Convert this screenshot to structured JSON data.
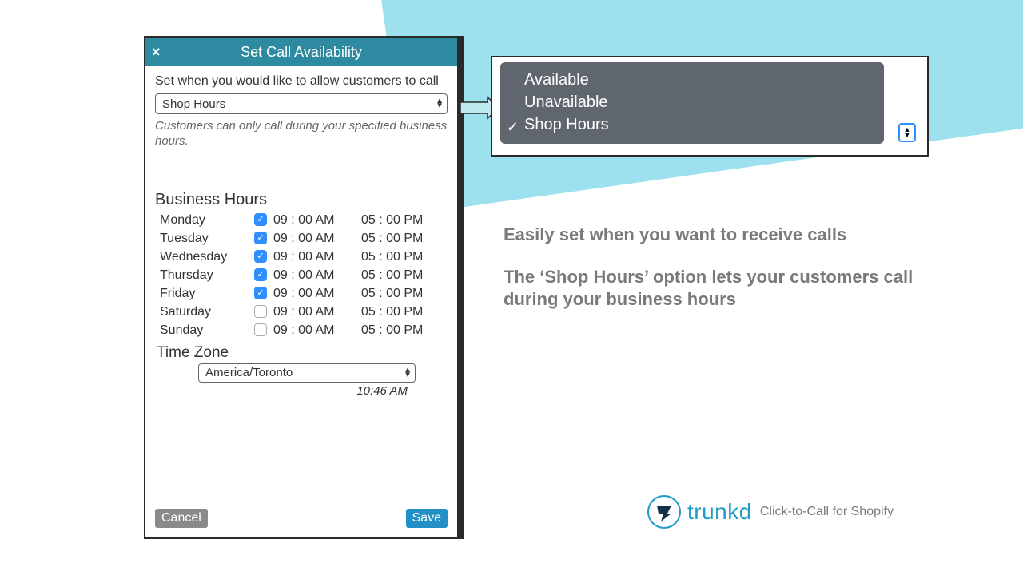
{
  "dialog": {
    "title": "Set Call Availability",
    "close_label": "×",
    "instruction": "Set when you would like to allow customers to call",
    "availability_select": {
      "value": "Shop Hours",
      "options": [
        "Available",
        "Unavailable",
        "Shop Hours"
      ],
      "selected_index": 2
    },
    "helper_text": "Customers can only call during your specified business hours.",
    "business_hours_heading": "Business Hours",
    "days": [
      {
        "name": "Monday",
        "enabled": true,
        "start": "09:00 AM",
        "end": "05:00 PM"
      },
      {
        "name": "Tuesday",
        "enabled": true,
        "start": "09:00 AM",
        "end": "05:00 PM"
      },
      {
        "name": "Wednesday",
        "enabled": true,
        "start": "09:00 AM",
        "end": "05:00 PM"
      },
      {
        "name": "Thursday",
        "enabled": true,
        "start": "09:00 AM",
        "end": "05:00 PM"
      },
      {
        "name": "Friday",
        "enabled": true,
        "start": "09:00 AM",
        "end": "05:00 PM"
      },
      {
        "name": "Saturday",
        "enabled": false,
        "start": "09:00 AM",
        "end": "05:00 PM"
      },
      {
        "name": "Sunday",
        "enabled": false,
        "start": "09:00 AM",
        "end": "05:00 PM"
      }
    ],
    "timezone_heading": "Time Zone",
    "timezone_value": "America/Toronto",
    "current_time": "10:46 AM",
    "cancel_label": "Cancel",
    "save_label": "Save"
  },
  "detail_menu": {
    "options": [
      "Available",
      "Unavailable",
      "Shop Hours"
    ],
    "selected_index": 2
  },
  "marketing": {
    "line1": "Easily set when you want to receive calls",
    "line2": "The ‘Shop Hours’ option lets your customers call during your business hours"
  },
  "brand": {
    "name": "trunkd",
    "tagline": "Click-to-Call for Shopify"
  },
  "colors": {
    "header_bg": "#2e8aa0",
    "accent_blue": "#2f8fff",
    "wedge": "#9ee1ee",
    "brand_blue": "#1d9bc9"
  }
}
